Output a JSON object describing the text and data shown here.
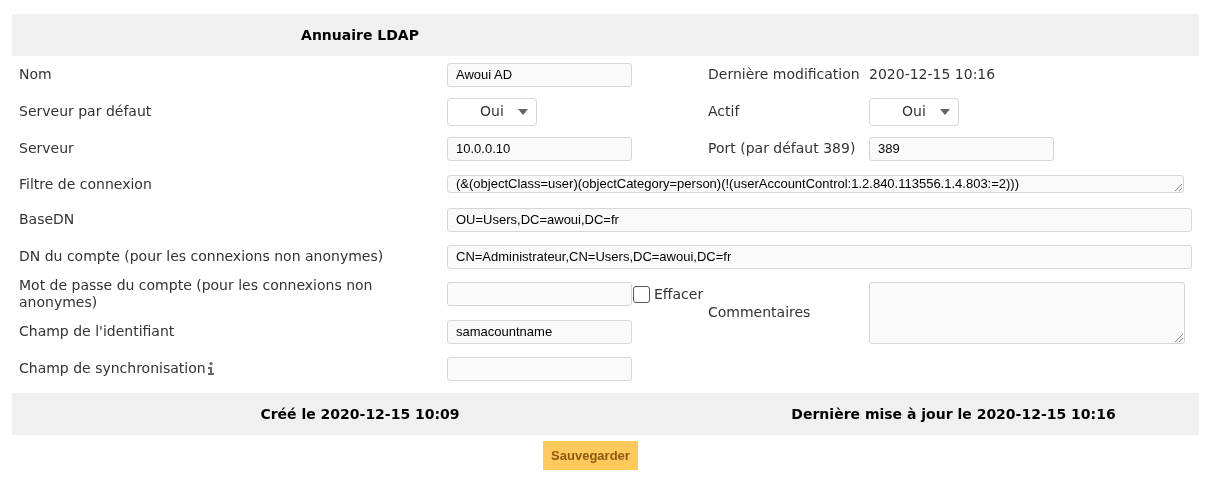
{
  "title": "Annuaire LDAP",
  "rows": [
    {
      "label": "Nom",
      "field": {
        "kind": "input",
        "value": "Awoui AD"
      },
      "side": {
        "kind": "static",
        "label": "Dernière modification",
        "value": "2020-12-15 10:16"
      }
    },
    {
      "label": "Serveur par défaut",
      "field": {
        "kind": "select",
        "value": "Oui"
      },
      "side": {
        "kind": "select",
        "label": "Actif",
        "value": "Oui"
      }
    },
    {
      "label": "Serveur",
      "field": {
        "kind": "input",
        "value": "10.0.0.10"
      },
      "side": {
        "kind": "input",
        "label": "Port (par défaut 389)",
        "value": "389"
      }
    },
    {
      "label": "Filtre de connexion",
      "field": {
        "kind": "textarea_wide",
        "value": "(&(objectClass=user)(objectCategory=person)(!(userAccountControl:1.2.840.113556.1.4.803:=2)))"
      }
    },
    {
      "label": "BaseDN",
      "field": {
        "kind": "input_wide",
        "value": "OU=Users,DC=awoui,DC=fr"
      }
    },
    {
      "label": "DN du compte (pour les connexions non anonymes)",
      "field": {
        "kind": "input_wide",
        "value": "CN=Administrateur,CN=Users,DC=awoui,DC=fr"
      }
    },
    {
      "label": "Mot de passe du compte (pour les connexions non anonymes)",
      "field": {
        "kind": "password",
        "clear": {
          "label": "Effacer",
          "checked": false
        }
      },
      "side": {
        "kind": "textarea",
        "label": "Commentaires"
      }
    },
    {
      "label": "Champ de l'identifiant",
      "field": {
        "kind": "input",
        "value": "samacountname"
      }
    },
    {
      "label": "Champ de synchronisation",
      "info": true,
      "field": {
        "kind": "input"
      }
    }
  ],
  "footer": {
    "created": "Créé le 2020-12-15 10:09",
    "updated": "Dernière mise à jour le 2020-12-15 10:16"
  },
  "save_button": "Sauvegarder"
}
